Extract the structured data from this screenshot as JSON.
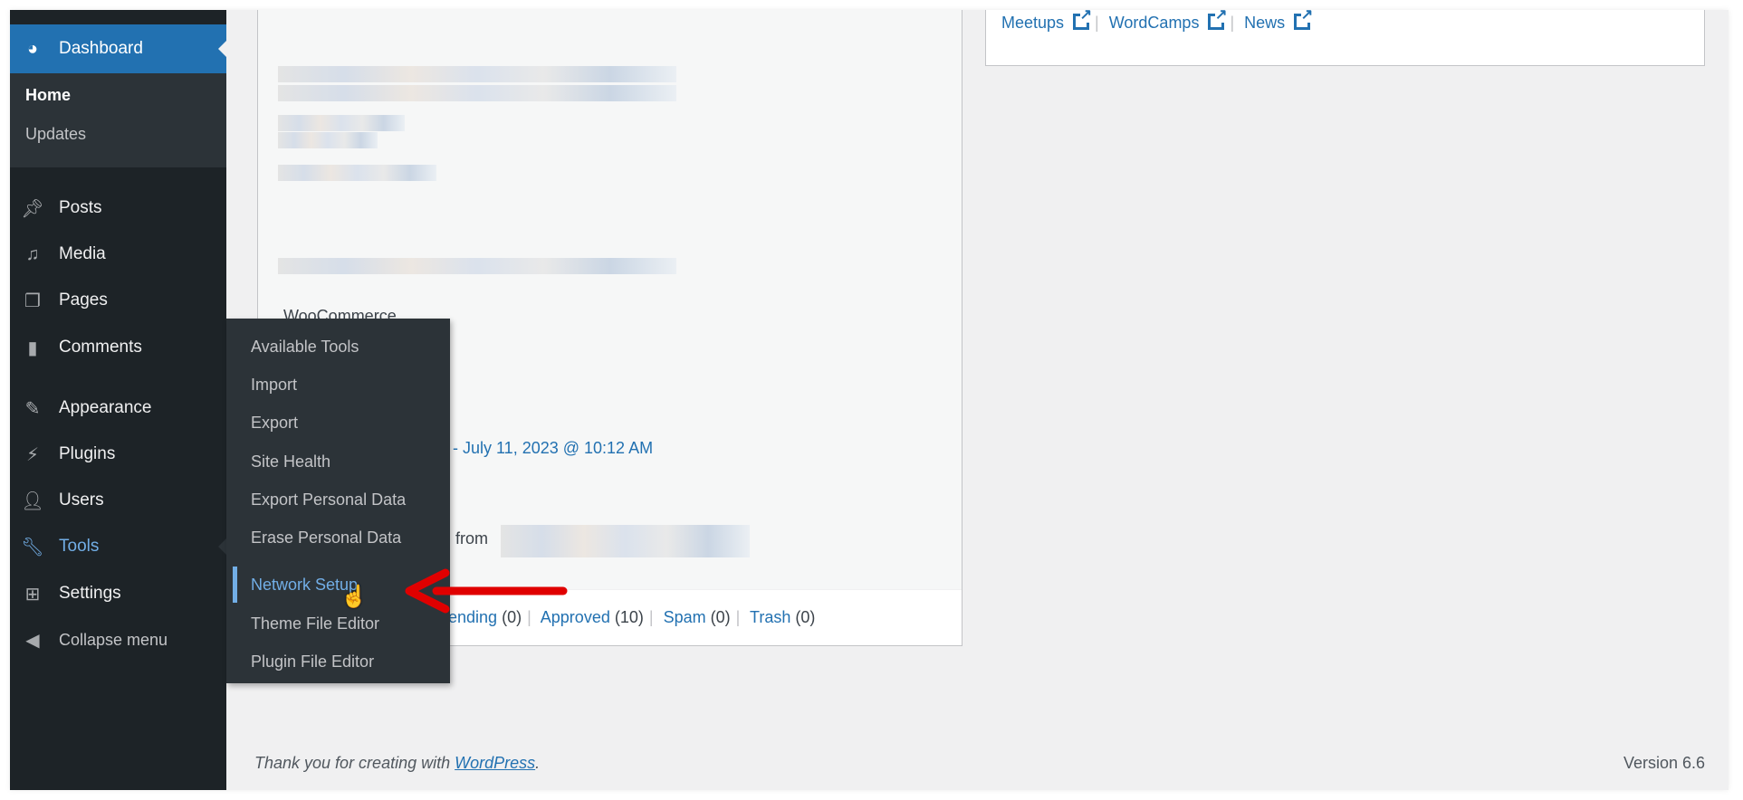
{
  "sidebar": {
    "dashboard": "Dashboard",
    "submenu": [
      "Home",
      "Updates"
    ],
    "items": [
      "Posts",
      "Media",
      "Pages",
      "Comments",
      "Appearance",
      "Plugins",
      "Users",
      "Tools",
      "Settings",
      "Collapse menu"
    ]
  },
  "tools_flyout": [
    "Available Tools",
    "Import",
    "Export",
    "Site Health",
    "Export Personal Data",
    "Erase Personal Data",
    "Network Setup",
    "Theme File Editor",
    "Plugin File Editor"
  ],
  "left_card": {
    "woocommerce": "WooCommerce",
    "date_link": "- July 11, 2023 @ 10:12 AM",
    "from": "from",
    "comment_filters": [
      {
        "label": "ending",
        "count": "(0)"
      },
      {
        "label": "Approved",
        "count": "(10)"
      },
      {
        "label": "Spam",
        "count": "(0)"
      },
      {
        "label": "Trash",
        "count": "(0)"
      }
    ]
  },
  "right_card": {
    "links": [
      "Meetups",
      "WordCamps",
      "News"
    ]
  },
  "footer": {
    "thanks_prefix": "Thank you for creating with ",
    "thanks_link": "WordPress",
    "thanks_suffix": ".",
    "version": "Version 6.6"
  },
  "colors": {
    "sidebar": "#1d2327",
    "accent": "#2271b1",
    "highlight": "#72aee6",
    "arrow": "#e00000"
  }
}
